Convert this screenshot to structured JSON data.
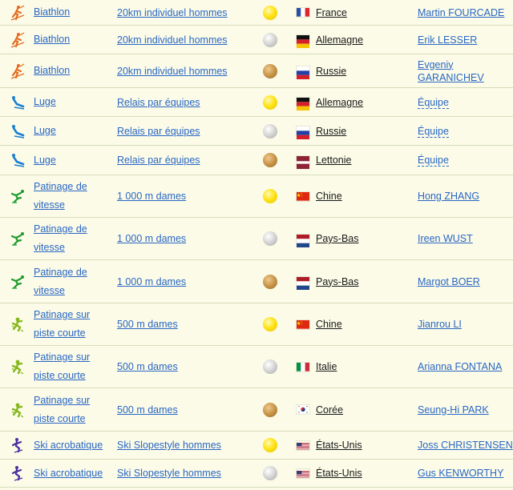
{
  "colors": {
    "background": "#fbfbe8",
    "link": "#2a67c4",
    "gold": "#ffe419",
    "silver": "#cfcfcf",
    "bronze": "#c89548",
    "biathlon_icon": "#e56b1f",
    "luge_icon": "#1b7fd0",
    "speed_skating_icon": "#1e9a2c",
    "short_track_icon": "#86b81c",
    "freestyle_icon": "#4a2fa0"
  },
  "rows": [
    {
      "sport": "Biathlon",
      "sport_icon": "biathlon-icon",
      "event": "20km individuel hommes",
      "medal": "gold",
      "flag": "france",
      "country": "France",
      "athlete": "Martin FOURCADE",
      "is_team": false
    },
    {
      "sport": "Biathlon",
      "sport_icon": "biathlon-icon",
      "event": "20km individuel hommes",
      "medal": "silver",
      "flag": "germany",
      "country": "Allemagne",
      "athlete": "Erik LESSER",
      "is_team": false
    },
    {
      "sport": "Biathlon",
      "sport_icon": "biathlon-icon",
      "event": "20km individuel hommes",
      "medal": "bronze",
      "flag": "russia",
      "country": "Russie",
      "athlete": "Evgeniy GARANICHEV",
      "is_team": false
    },
    {
      "sport": "Luge",
      "sport_icon": "luge-icon",
      "event": "Relais par équipes",
      "medal": "gold",
      "flag": "germany",
      "country": "Allemagne",
      "athlete": "Équipe",
      "is_team": true
    },
    {
      "sport": "Luge",
      "sport_icon": "luge-icon",
      "event": "Relais par équipes",
      "medal": "silver",
      "flag": "russia",
      "country": "Russie",
      "athlete": "Équipe",
      "is_team": true
    },
    {
      "sport": "Luge",
      "sport_icon": "luge-icon",
      "event": "Relais par équipes",
      "medal": "bronze",
      "flag": "latvia",
      "country": "Lettonie",
      "athlete": "Équipe",
      "is_team": true
    },
    {
      "sport": "Patinage de vitesse",
      "sport_icon": "speed-skating-icon",
      "event": "1 000 m dames",
      "medal": "gold",
      "flag": "china",
      "country": "Chine",
      "athlete": "Hong ZHANG",
      "is_team": false
    },
    {
      "sport": "Patinage de vitesse",
      "sport_icon": "speed-skating-icon",
      "event": "1 000 m dames",
      "medal": "silver",
      "flag": "netherlands",
      "country": "Pays-Bas",
      "athlete": "Ireen WUST",
      "is_team": false
    },
    {
      "sport": "Patinage de vitesse",
      "sport_icon": "speed-skating-icon",
      "event": "1 000 m dames",
      "medal": "bronze",
      "flag": "netherlands",
      "country": "Pays-Bas",
      "athlete": "Margot BOER",
      "is_team": false
    },
    {
      "sport": "Patinage sur piste courte",
      "sport_icon": "short-track-icon",
      "event": "500 m dames",
      "medal": "gold",
      "flag": "china",
      "country": "Chine",
      "athlete": "Jianrou LI",
      "is_team": false
    },
    {
      "sport": "Patinage sur piste courte",
      "sport_icon": "short-track-icon",
      "event": "500 m dames",
      "medal": "silver",
      "flag": "italy",
      "country": "Italie",
      "athlete": "Arianna FONTANA",
      "is_team": false
    },
    {
      "sport": "Patinage sur piste courte",
      "sport_icon": "short-track-icon",
      "event": "500 m dames",
      "medal": "bronze",
      "flag": "korea",
      "country": "Corée",
      "athlete": "Seung-Hi PARK",
      "is_team": false
    },
    {
      "sport": "Ski acrobatique",
      "sport_icon": "freestyle-ski-icon",
      "event": "Ski Slopestyle hommes",
      "medal": "gold",
      "flag": "usa",
      "country": "États-Unis",
      "athlete": "Joss CHRISTENSEN",
      "is_team": false
    },
    {
      "sport": "Ski acrobatique",
      "sport_icon": "freestyle-ski-icon",
      "event": "Ski Slopestyle hommes",
      "medal": "silver",
      "flag": "usa",
      "country": "États-Unis",
      "athlete": "Gus KENWORTHY",
      "is_team": false
    }
  ]
}
